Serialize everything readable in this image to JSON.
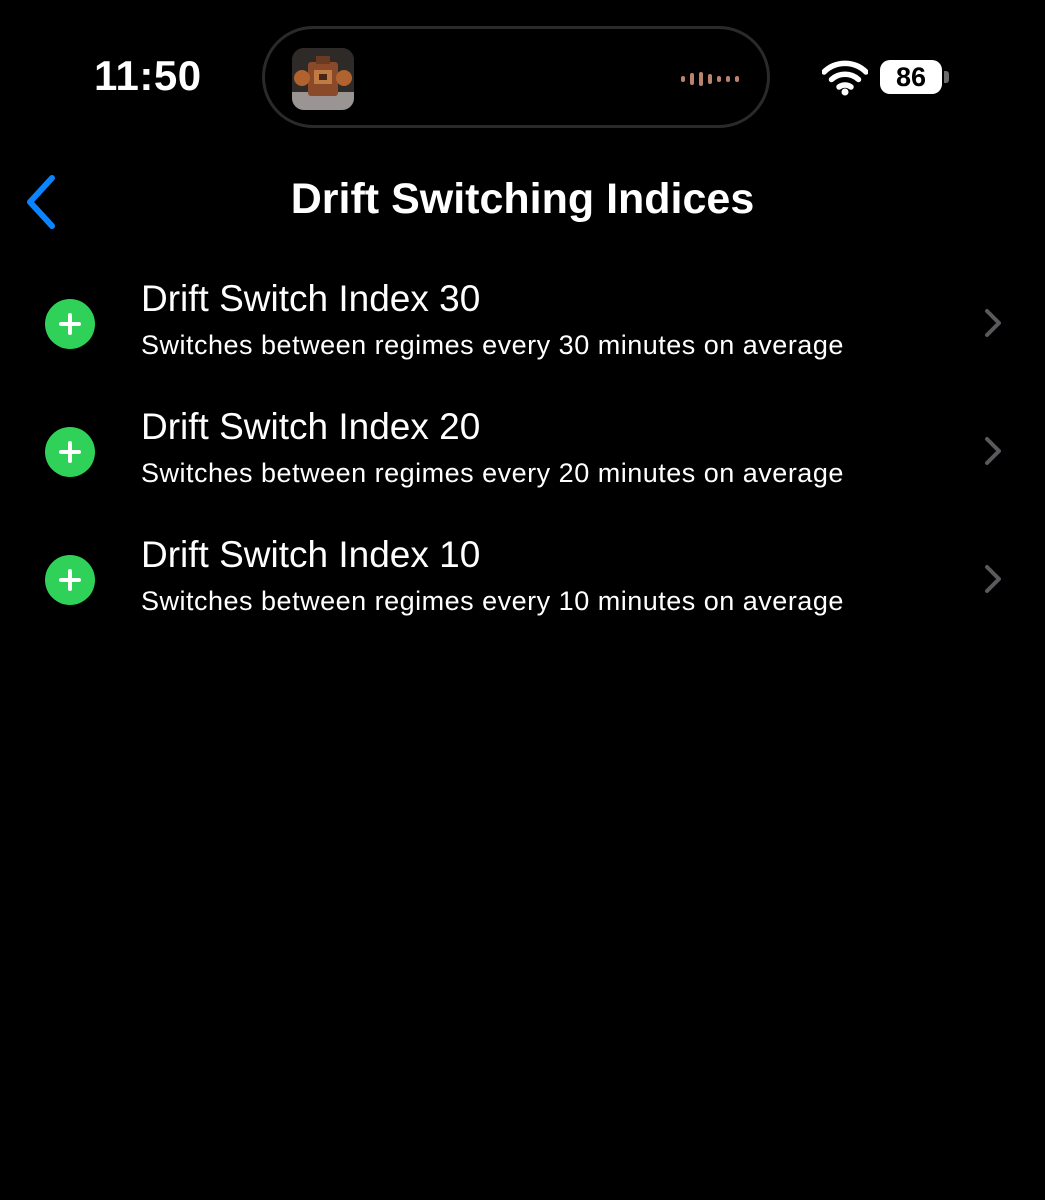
{
  "status_bar": {
    "time": "11:50",
    "battery_level": "86",
    "wifi_icon": "wifi-icon",
    "now_playing_icon": "album-artwork",
    "waveform_icon": "audio-waveform-icon"
  },
  "nav": {
    "back_icon": "chevron-left-icon",
    "title": "Drift Switching Indices"
  },
  "list": {
    "items": [
      {
        "title": "Drift Switch Index 30",
        "subtitle": "Switches between regimes every 30 minutes on average",
        "icon": "plus-circle-icon"
      },
      {
        "title": "Drift Switch Index 20",
        "subtitle": "Switches between regimes every 20 minutes on average",
        "icon": "plus-circle-icon"
      },
      {
        "title": "Drift Switch Index 10",
        "subtitle": "Switches between regimes every 10 minutes on average",
        "icon": "plus-circle-icon"
      }
    ]
  },
  "colors": {
    "background": "#000000",
    "accent_blue": "#0a84ff",
    "add_green": "#30d158",
    "chevron_gray": "#5a5a5e",
    "text": "#ffffff"
  }
}
